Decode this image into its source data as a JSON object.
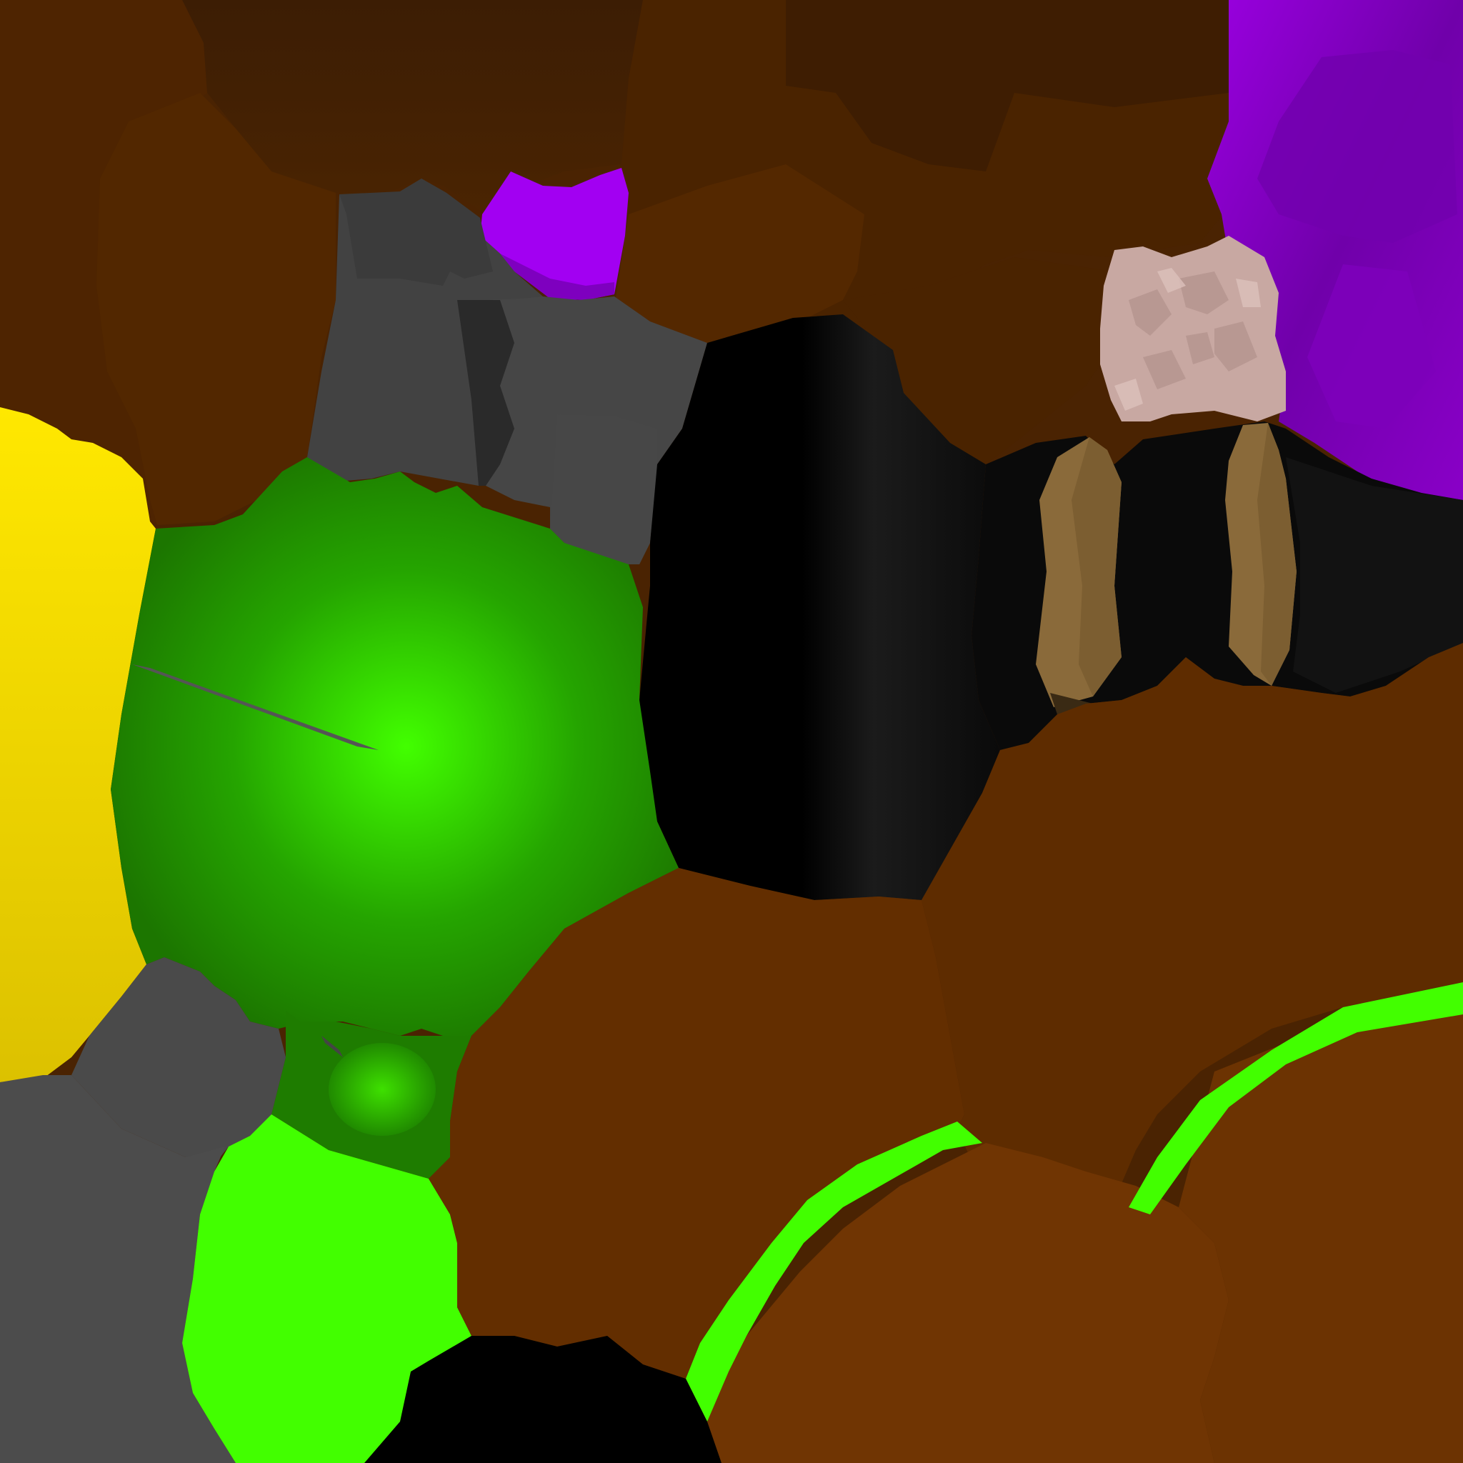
{
  "scene": {
    "kind": "3d-voxel-viewport",
    "hud_text": [],
    "colors": {
      "background_brown": "#3a1e06",
      "wood_dark": "#3d1f05",
      "wood_mid": "#4e2602",
      "wood_light": "#5e2e00",
      "ground_brown": "#6a3202",
      "ground_brown_light": "#743604",
      "leaf_green": "#1e7a00",
      "leaf_green_bright": "#42ff00",
      "stone_grey": "#424242",
      "stone_grey_light": "#4c4c4c",
      "coal_black": "#0c0c0c",
      "gold_yellow": "#f2d400",
      "amethyst_purple": "#8a00c8",
      "amethyst_bright": "#a500f5",
      "pink_quartz": "#c7a6a0",
      "tan_plank": "#8a6a3a"
    },
    "objects": [
      "wood-block-icon",
      "purple-crystal-icon",
      "stone-block-icon",
      "coal-block-icon",
      "leaf-sphere-icon",
      "gold-block-icon",
      "pink-quartz-icon",
      "tan-plank-icon",
      "grass-strip-icon"
    ]
  }
}
